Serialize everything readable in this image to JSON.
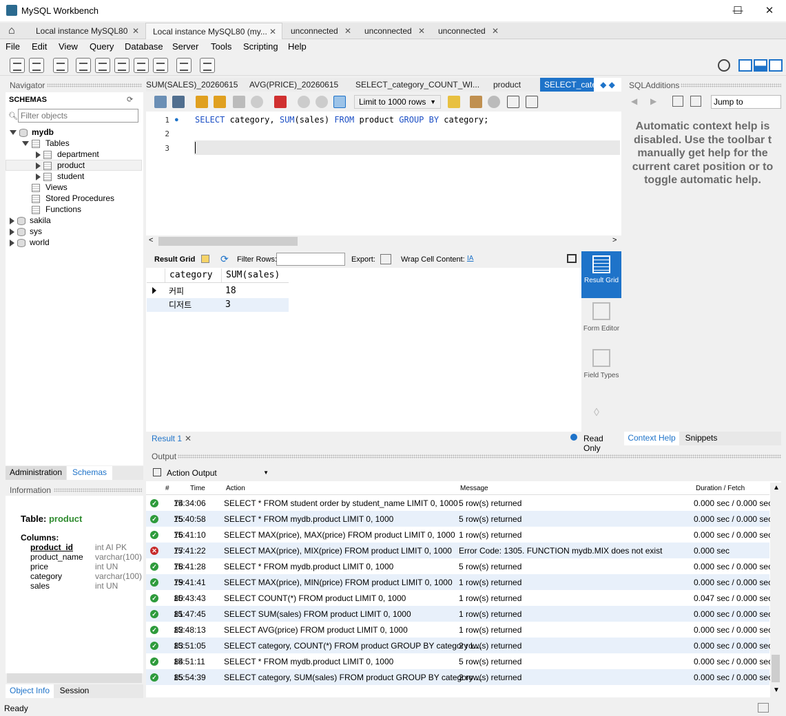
{
  "window": {
    "title": "MySQL Workbench",
    "minimize": "—",
    "maximize": "☐",
    "close": "✕"
  },
  "conn_tabs": [
    {
      "label": "Local instance MySQL80"
    },
    {
      "label": "Local instance MySQL80 (my..."
    },
    {
      "label": "unconnected"
    },
    {
      "label": "unconnected"
    },
    {
      "label": "unconnected"
    }
  ],
  "menu": [
    "File",
    "Edit",
    "View",
    "Query",
    "Database",
    "Server",
    "Tools",
    "Scripting",
    "Help"
  ],
  "navigator": {
    "title": "Navigator",
    "schemas_label": "SCHEMAS",
    "filter_placeholder": "Filter objects",
    "tree": {
      "db": "mydb",
      "tables": "Tables",
      "table_items": [
        "department",
        "product",
        "student"
      ],
      "views": "Views",
      "procs": "Stored Procedures",
      "functions": "Functions",
      "others": [
        "sakila",
        "sys",
        "world"
      ]
    },
    "tab_admin": "Administration",
    "tab_schemas": "Schemas"
  },
  "information": {
    "title": "Information",
    "table_label": "Table:",
    "table_name": "product",
    "columns_label": "Columns:",
    "columns": [
      {
        "name": "product_id",
        "type": "int AI PK"
      },
      {
        "name": "product_name",
        "type": "varchar(100)"
      },
      {
        "name": "price",
        "type": "int UN"
      },
      {
        "name": "category",
        "type": "varchar(100)"
      },
      {
        "name": "sales",
        "type": "int UN"
      }
    ],
    "tab_object_info": "Object Info",
    "tab_session": "Session"
  },
  "query_tabs": [
    {
      "label": "SUM(SALES)_20260615"
    },
    {
      "label": "AVG(PRICE)_20260615"
    },
    {
      "label": "SELECT_category_COUNT_WI..."
    },
    {
      "label": "product"
    },
    {
      "label": "SELECT_cate"
    }
  ],
  "editor_toolbar": {
    "limit": "Limit to 1000 rows"
  },
  "editor": {
    "lines": [
      "1",
      "2",
      "3"
    ],
    "line1_kw1": "SELECT",
    "line1_a": " category, ",
    "line1_kw2": "SUM",
    "line1_b": "(sales) ",
    "line1_kw3": "FROM",
    "line1_c": " product ",
    "line1_kw4": "GROUP BY",
    "line1_d": " category;"
  },
  "result_toolbar": {
    "result_grid": "Result Grid",
    "filter_rows": "Filter Rows:",
    "export": "Export:",
    "wrap": "Wrap Cell Content:"
  },
  "result_grid": {
    "columns": [
      "category",
      "SUM(sales)"
    ],
    "rows": [
      [
        "커피",
        "18"
      ],
      [
        "디저트",
        "3"
      ]
    ]
  },
  "result_side": {
    "result_grid": "Result Grid",
    "form_editor": "Form Editor",
    "field_types": "Field Types"
  },
  "result_footer": {
    "tab": "Result 1",
    "readonly": "Read Only"
  },
  "sql_additions": {
    "title": "SQLAdditions",
    "jump_to": "Jump to",
    "help_lines": [
      "Automatic context help is",
      "disabled. Use the toolbar t",
      "manually get help for the",
      "current caret position or to",
      "toggle automatic help."
    ],
    "tab_context": "Context Help",
    "tab_snippets": "Snippets"
  },
  "output": {
    "title": "Output",
    "selector": "Action Output",
    "headers": {
      "num": "#",
      "time": "Time",
      "action": "Action",
      "message": "Message",
      "duration": "Duration / Fetch"
    },
    "rows": [
      {
        "status": "ok",
        "num": "74",
        "time": "15:34:06",
        "action": "SELECT * FROM student order by student_name LIMIT 0, 1000",
        "message": "5 row(s) returned",
        "duration": "0.000 sec / 0.000 sec"
      },
      {
        "status": "ok",
        "num": "75",
        "time": "15:40:58",
        "action": "SELECT * FROM mydb.product LIMIT 0, 1000",
        "message": "5 row(s) returned",
        "duration": "0.000 sec / 0.000 sec"
      },
      {
        "status": "ok",
        "num": "76",
        "time": "15:41:10",
        "action": "SELECT MAX(price), MAX(price) FROM product LIMIT 0, 1000",
        "message": "1 row(s) returned",
        "duration": "0.000 sec / 0.000 sec"
      },
      {
        "status": "err",
        "num": "77",
        "time": "15:41:22",
        "action": "SELECT MAX(price), MIX(price) FROM product LIMIT 0, 1000",
        "message": "Error Code: 1305. FUNCTION mydb.MIX does not exist",
        "duration": "0.000 sec"
      },
      {
        "status": "ok",
        "num": "78",
        "time": "15:41:28",
        "action": "SELECT * FROM mydb.product LIMIT 0, 1000",
        "message": "5 row(s) returned",
        "duration": "0.000 sec / 0.000 sec"
      },
      {
        "status": "ok",
        "num": "79",
        "time": "15:41:41",
        "action": "SELECT MAX(price), MIN(price) FROM product LIMIT 0, 1000",
        "message": "1 row(s) returned",
        "duration": "0.000 sec / 0.000 sec"
      },
      {
        "status": "ok",
        "num": "80",
        "time": "15:43:43",
        "action": "SELECT COUNT(*) FROM product LIMIT 0, 1000",
        "message": "1 row(s) returned",
        "duration": "0.047 sec / 0.000 sec"
      },
      {
        "status": "ok",
        "num": "81",
        "time": "15:47:45",
        "action": "SELECT SUM(sales) FROM product LIMIT 0, 1000",
        "message": "1 row(s) returned",
        "duration": "0.000 sec / 0.000 sec"
      },
      {
        "status": "ok",
        "num": "82",
        "time": "15:48:13",
        "action": "SELECT AVG(price) FROM product LIMIT 0, 1000",
        "message": "1 row(s) returned",
        "duration": "0.000 sec / 0.000 sec"
      },
      {
        "status": "ok",
        "num": "83",
        "time": "15:51:05",
        "action": "SELECT category, COUNT(*) FROM product GROUP BY category L...",
        "message": "2 row(s) returned",
        "duration": "0.000 sec / 0.000 sec"
      },
      {
        "status": "ok",
        "num": "84",
        "time": "15:51:11",
        "action": "SELECT * FROM mydb.product LIMIT 0, 1000",
        "message": "5 row(s) returned",
        "duration": "0.000 sec / 0.000 sec"
      },
      {
        "status": "ok",
        "num": "85",
        "time": "15:54:39",
        "action": "SELECT category, SUM(sales) FROM product GROUP BY category ...",
        "message": "2 row(s) returned",
        "duration": "0.000 sec / 0.000 sec"
      }
    ]
  },
  "status": {
    "text": "Ready"
  },
  "colors": {
    "accent": "#1e73c9",
    "ok": "#2e9b3c",
    "error": "#c72b2b",
    "alt_row": "#e8f0fa",
    "product_green": "#2e8b2e"
  }
}
